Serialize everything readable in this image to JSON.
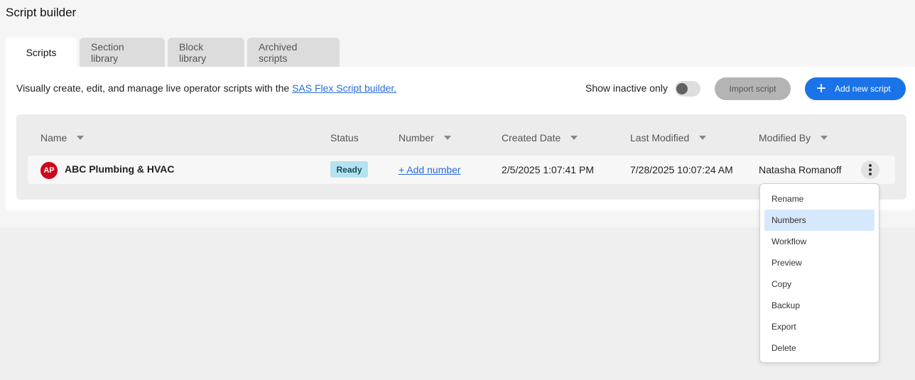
{
  "header": {
    "title": "Script builder"
  },
  "tabs": [
    {
      "label": "Scripts",
      "active": true
    },
    {
      "label": "Section library",
      "active": false
    },
    {
      "label": "Block library",
      "active": false
    },
    {
      "label": "Archived scripts",
      "active": false
    }
  ],
  "toolbar": {
    "description_prefix": "Visually create, edit, and manage live operator scripts with the ",
    "description_link": "SAS Flex Script builder.",
    "inactive_label": "Show inactive only",
    "inactive_on": false,
    "import_label": "Import script",
    "add_label": "Add new script",
    "add_icon": "plus-icon"
  },
  "table": {
    "columns": [
      "Name",
      "Status",
      "Number",
      "Created Date",
      "Last Modified",
      "Modified By"
    ],
    "rows": [
      {
        "avatar": "AP",
        "name": "ABC Plumbing & HVAC",
        "status": "Ready",
        "number": "+ Add number",
        "created": "2/5/2025 1:07:41 PM",
        "modified": "7/28/2025 10:07:24 AM",
        "modified_by": "Natasha Romanoff"
      }
    ]
  },
  "context_menu": {
    "items": [
      "Rename",
      "Numbers",
      "Workflow",
      "Preview",
      "Copy",
      "Backup",
      "Export",
      "Delete"
    ],
    "highlighted": "Numbers"
  },
  "colors": {
    "primary": "#1a73e8",
    "avatar": "#d0021b",
    "status_ready": "#b2e3ef",
    "menu_highlight": "#d6e8fb"
  }
}
